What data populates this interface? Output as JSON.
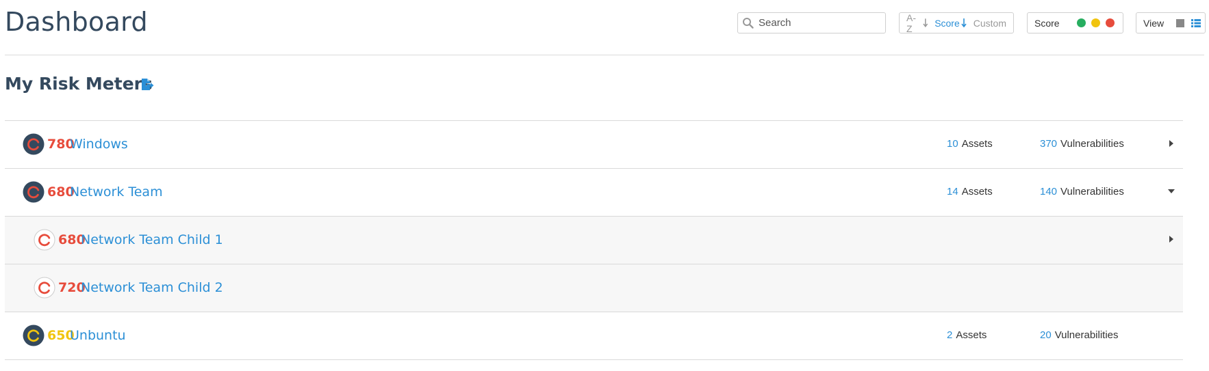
{
  "header": {
    "title": "Dashboard",
    "search": {
      "placeholder": "Search",
      "value": ""
    },
    "sort": {
      "options": [
        {
          "label": "A-Z",
          "active": false
        },
        {
          "label": "Score",
          "active": true
        },
        {
          "label": "Custom",
          "active": false
        }
      ]
    },
    "score_filter": {
      "label": "Score",
      "dots": [
        {
          "name": "green",
          "color": "#27ae60"
        },
        {
          "name": "yellow",
          "color": "#f1c40f"
        },
        {
          "name": "red",
          "color": "#e74c3c"
        }
      ]
    },
    "view": {
      "label": "View",
      "modes": [
        "tile-icon",
        "list-icon"
      ],
      "active": "list"
    }
  },
  "section": {
    "title": "My Risk Meters",
    "export_icon": "export-icon"
  },
  "colors": {
    "accent": "#2b8fd6",
    "high": "#e74c3c",
    "medium": "#f1c40f",
    "heading": "#34495e"
  },
  "meters": [
    {
      "score": "780",
      "name": "Windows",
      "level": "high",
      "assets": "10",
      "assets_label": "Assets",
      "vulns": "370",
      "vulns_label": "Vulnerabilities",
      "toggle": "chevron-right-icon",
      "child": false
    },
    {
      "score": "680",
      "name": "Network Team",
      "level": "high",
      "assets": "14",
      "assets_label": "Assets",
      "vulns": "140",
      "vulns_label": "Vulnerabilities",
      "toggle": "chevron-down-icon",
      "child": false
    },
    {
      "score": "680",
      "name": "Network Team Child 1",
      "level": "high",
      "toggle": "chevron-right-icon",
      "child": true
    },
    {
      "score": "720",
      "name": "Network Team Child 2",
      "level": "high",
      "child": true
    },
    {
      "score": "650",
      "name": "Unbuntu",
      "level": "medium",
      "assets": "2",
      "assets_label": "Assets",
      "vulns": "20",
      "vulns_label": "Vulnerabilities",
      "child": false
    }
  ]
}
